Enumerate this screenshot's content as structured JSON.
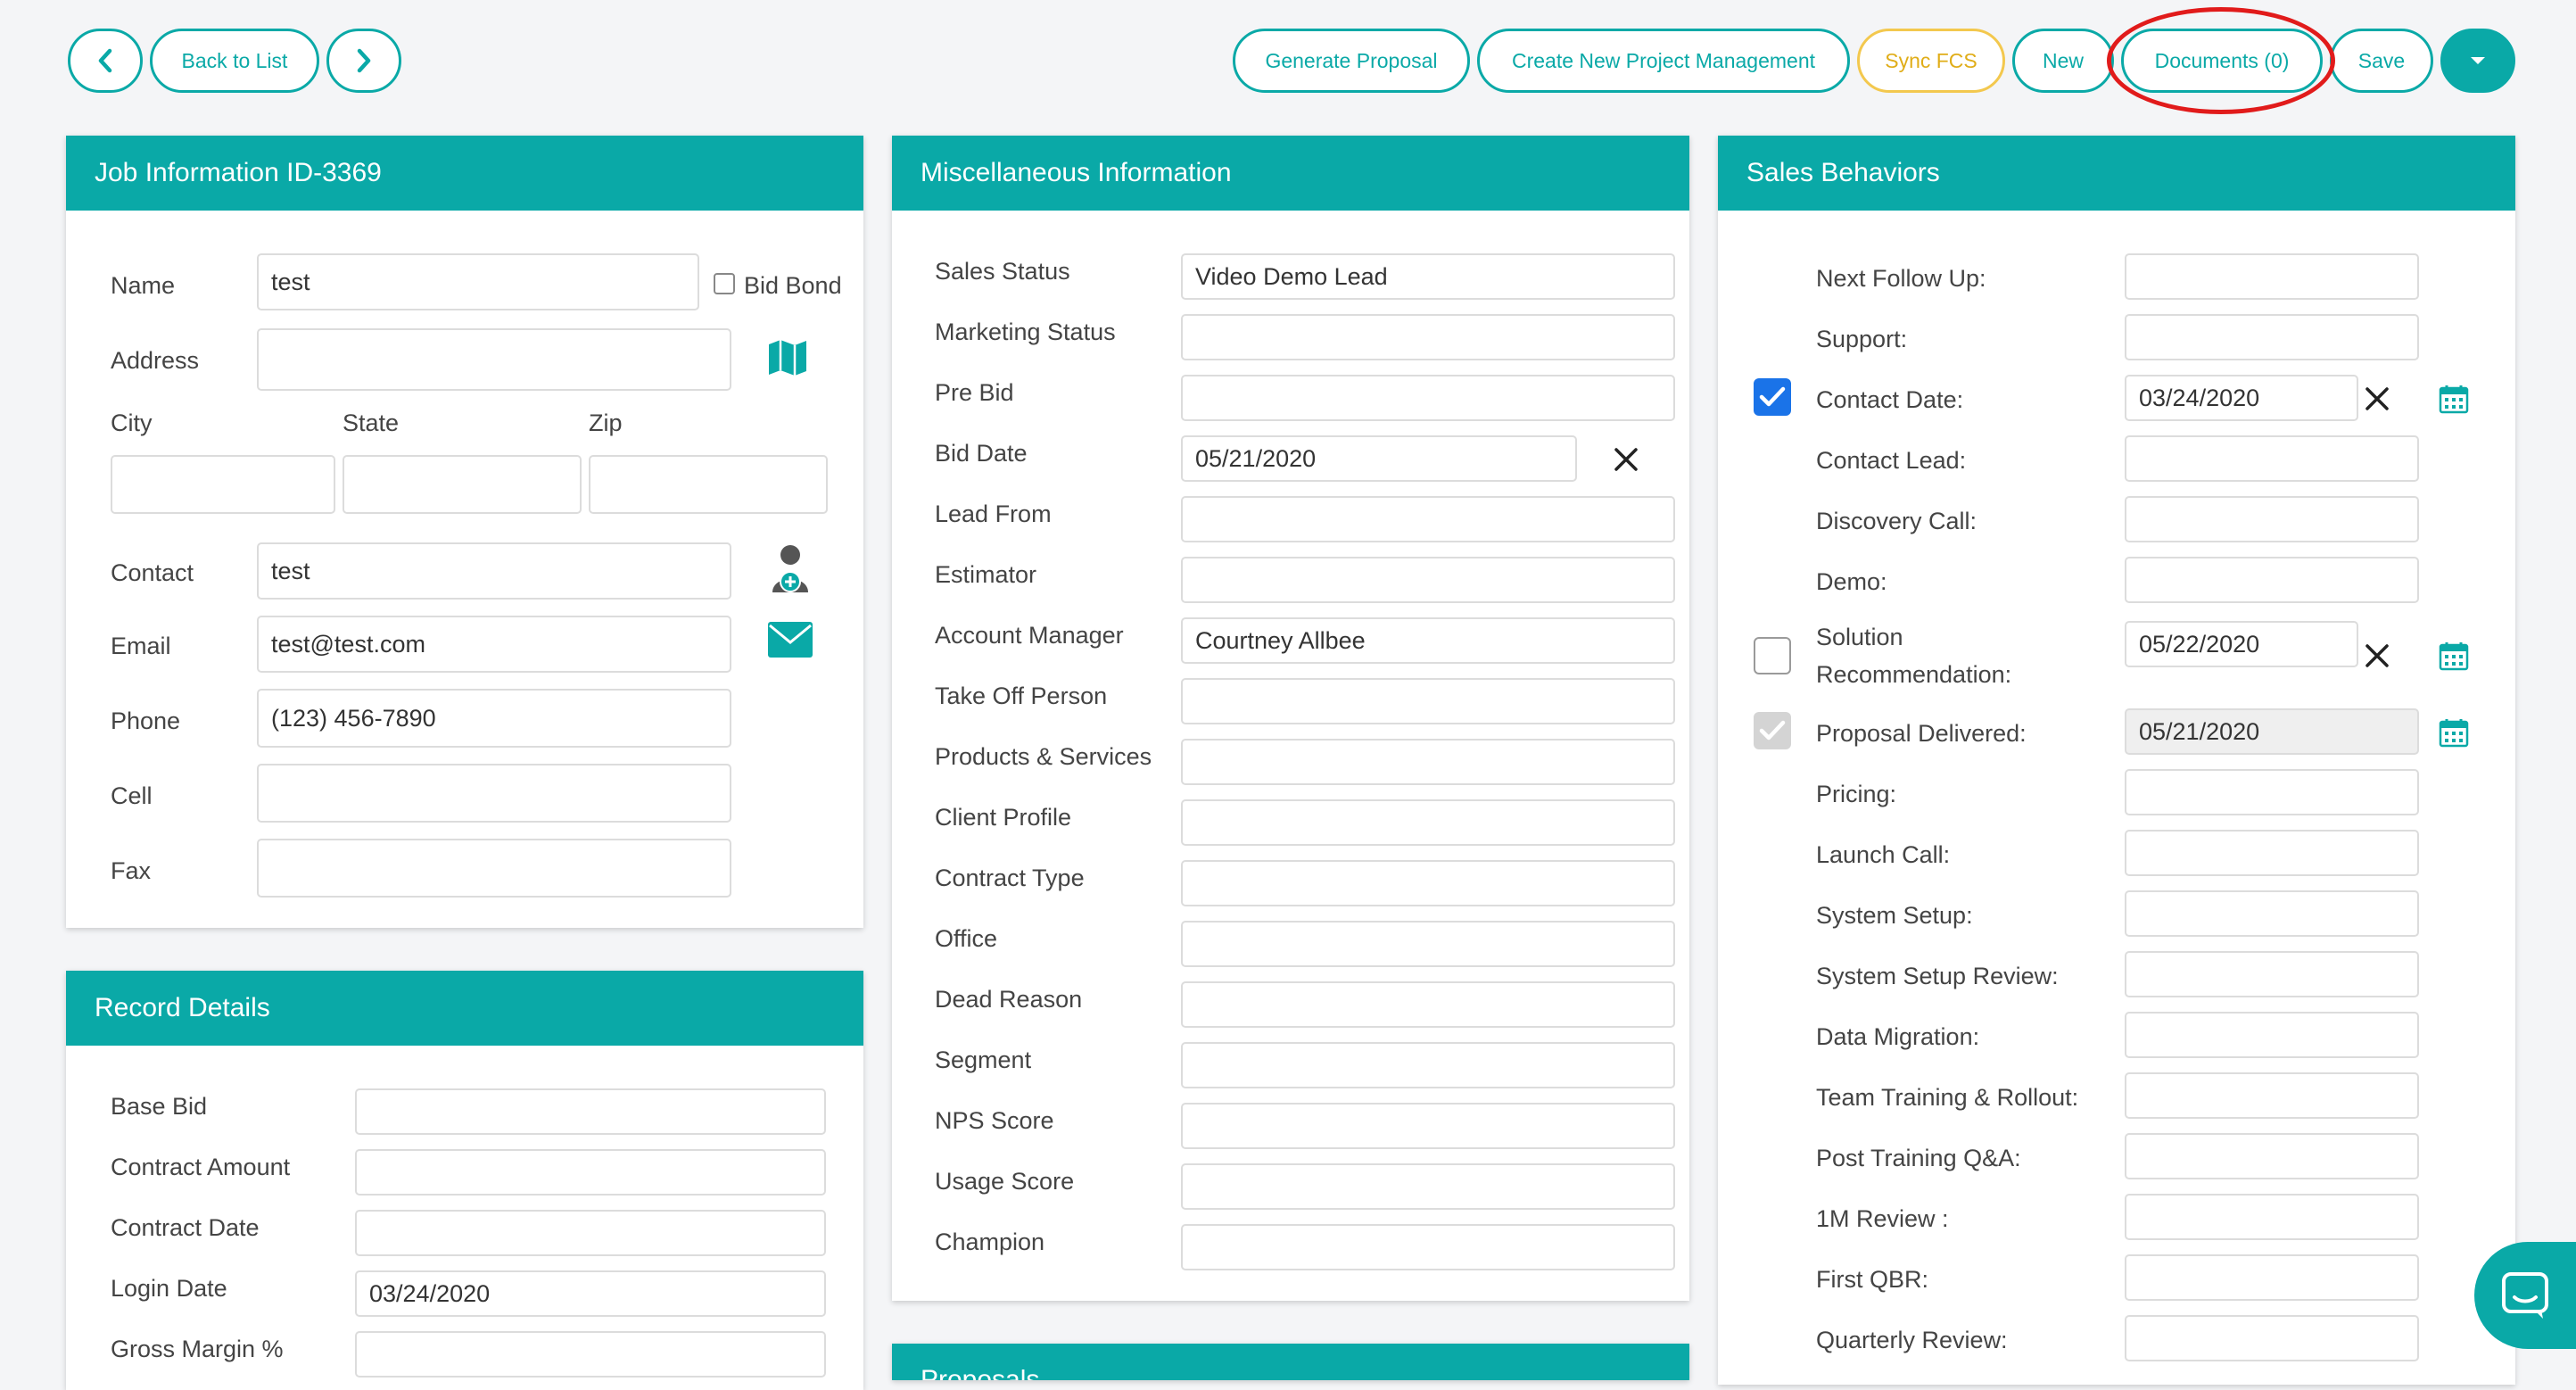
{
  "toolbar": {
    "back_label": "Back to List",
    "generate_proposal": "Generate Proposal",
    "create_pm": "Create New Project Management",
    "sync_fcs": "Sync FCS",
    "new": "New",
    "documents": "Documents (0)",
    "save": "Save"
  },
  "job": {
    "title": "Job Information ID-3369",
    "name_label": "Name",
    "name_value": "test",
    "bid_bond_label": "Bid Bond",
    "address_label": "Address",
    "address_value": "",
    "city_label": "City",
    "state_label": "State",
    "zip_label": "Zip",
    "city_value": "",
    "state_value": "",
    "zip_value": "",
    "contact_label": "Contact",
    "contact_value": "test",
    "email_label": "Email",
    "email_value": "test@test.com",
    "phone_label": "Phone",
    "phone_value": "(123) 456-7890",
    "cell_label": "Cell",
    "cell_value": "",
    "fax_label": "Fax",
    "fax_value": ""
  },
  "record": {
    "title": "Record Details",
    "rows": [
      {
        "label": "Base Bid",
        "value": ""
      },
      {
        "label": "Contract Amount",
        "value": ""
      },
      {
        "label": "Contract Date",
        "value": ""
      },
      {
        "label": "Login Date",
        "value": "03/24/2020"
      },
      {
        "label": "Gross Margin %",
        "value": ""
      }
    ]
  },
  "misc": {
    "title": "Miscellaneous Information",
    "rows": [
      {
        "label": "Sales Status",
        "value": "Video Demo Lead"
      },
      {
        "label": "Marketing Status",
        "value": ""
      },
      {
        "label": "Pre Bid",
        "value": ""
      },
      {
        "label": "Bid Date",
        "value": "05/21/2020"
      },
      {
        "label": "Lead From",
        "value": ""
      },
      {
        "label": "Estimator",
        "value": ""
      },
      {
        "label": "Account Manager",
        "value": "Courtney Allbee"
      },
      {
        "label": "Take Off Person",
        "value": ""
      },
      {
        "label": "Products & Services",
        "value": ""
      },
      {
        "label": "Client Profile",
        "value": ""
      },
      {
        "label": "Contract Type",
        "value": ""
      },
      {
        "label": "Office",
        "value": ""
      },
      {
        "label": "Dead Reason",
        "value": ""
      },
      {
        "label": "Segment",
        "value": ""
      },
      {
        "label": "NPS Score",
        "value": ""
      },
      {
        "label": "Usage Score",
        "value": ""
      },
      {
        "label": "Champion",
        "value": ""
      }
    ]
  },
  "proposals": {
    "title": "Proposals"
  },
  "sales": {
    "title": "Sales Behaviors",
    "rows": [
      {
        "label": "Next Follow Up:",
        "value": ""
      },
      {
        "label": "Support:",
        "value": ""
      },
      {
        "label": "Contact Date:",
        "value": "03/24/2020"
      },
      {
        "label": "Contact Lead:",
        "value": ""
      },
      {
        "label": "Discovery Call:",
        "value": ""
      },
      {
        "label": "Demo:",
        "value": ""
      },
      {
        "label": "Solution",
        "label2": "Recommendation:",
        "value": "05/22/2020"
      },
      {
        "label": "Proposal Delivered:",
        "value": "05/21/2020"
      },
      {
        "label": "Pricing:",
        "value": ""
      },
      {
        "label": "Launch Call:",
        "value": ""
      },
      {
        "label": "System Setup:",
        "value": ""
      },
      {
        "label": "System Setup Review:",
        "value": ""
      },
      {
        "label": "Data Migration:",
        "value": ""
      },
      {
        "label": "Team Training & Rollout:",
        "value": ""
      },
      {
        "label": "Post Training Q&A:",
        "value": ""
      },
      {
        "label": "1M Review :",
        "value": ""
      },
      {
        "label": "First QBR:",
        "value": ""
      },
      {
        "label": "Quarterly Review:",
        "value": ""
      }
    ]
  },
  "colors": {
    "accent": "#0aa9a7",
    "sync": "#f3c84e",
    "annotation": "#e11b1b",
    "checkbox_on": "#1a73e8"
  }
}
